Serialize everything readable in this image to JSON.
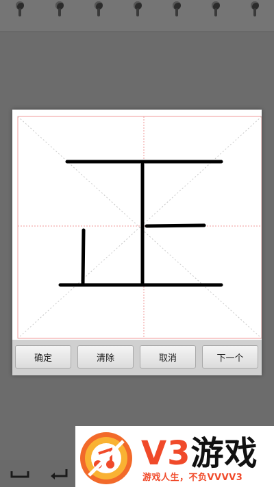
{
  "dialog": {
    "character_glyph": "正",
    "buttons": [
      {
        "label": "确定"
      },
      {
        "label": "清除"
      },
      {
        "label": "取消"
      },
      {
        "label": "下一个"
      }
    ]
  },
  "nav": {
    "icons": [
      "space-key-icon",
      "enter-key-icon"
    ]
  },
  "banner": {
    "title_part1": "V3",
    "title_part2": "游戏",
    "slogan": "游戏人生，不负VVVV3"
  },
  "colors": {
    "background": "#6e6e6e",
    "canvas": "#ffffff",
    "guide_line": "#f29a9a",
    "stroke": "#000000",
    "brand": "#f04a2a"
  }
}
